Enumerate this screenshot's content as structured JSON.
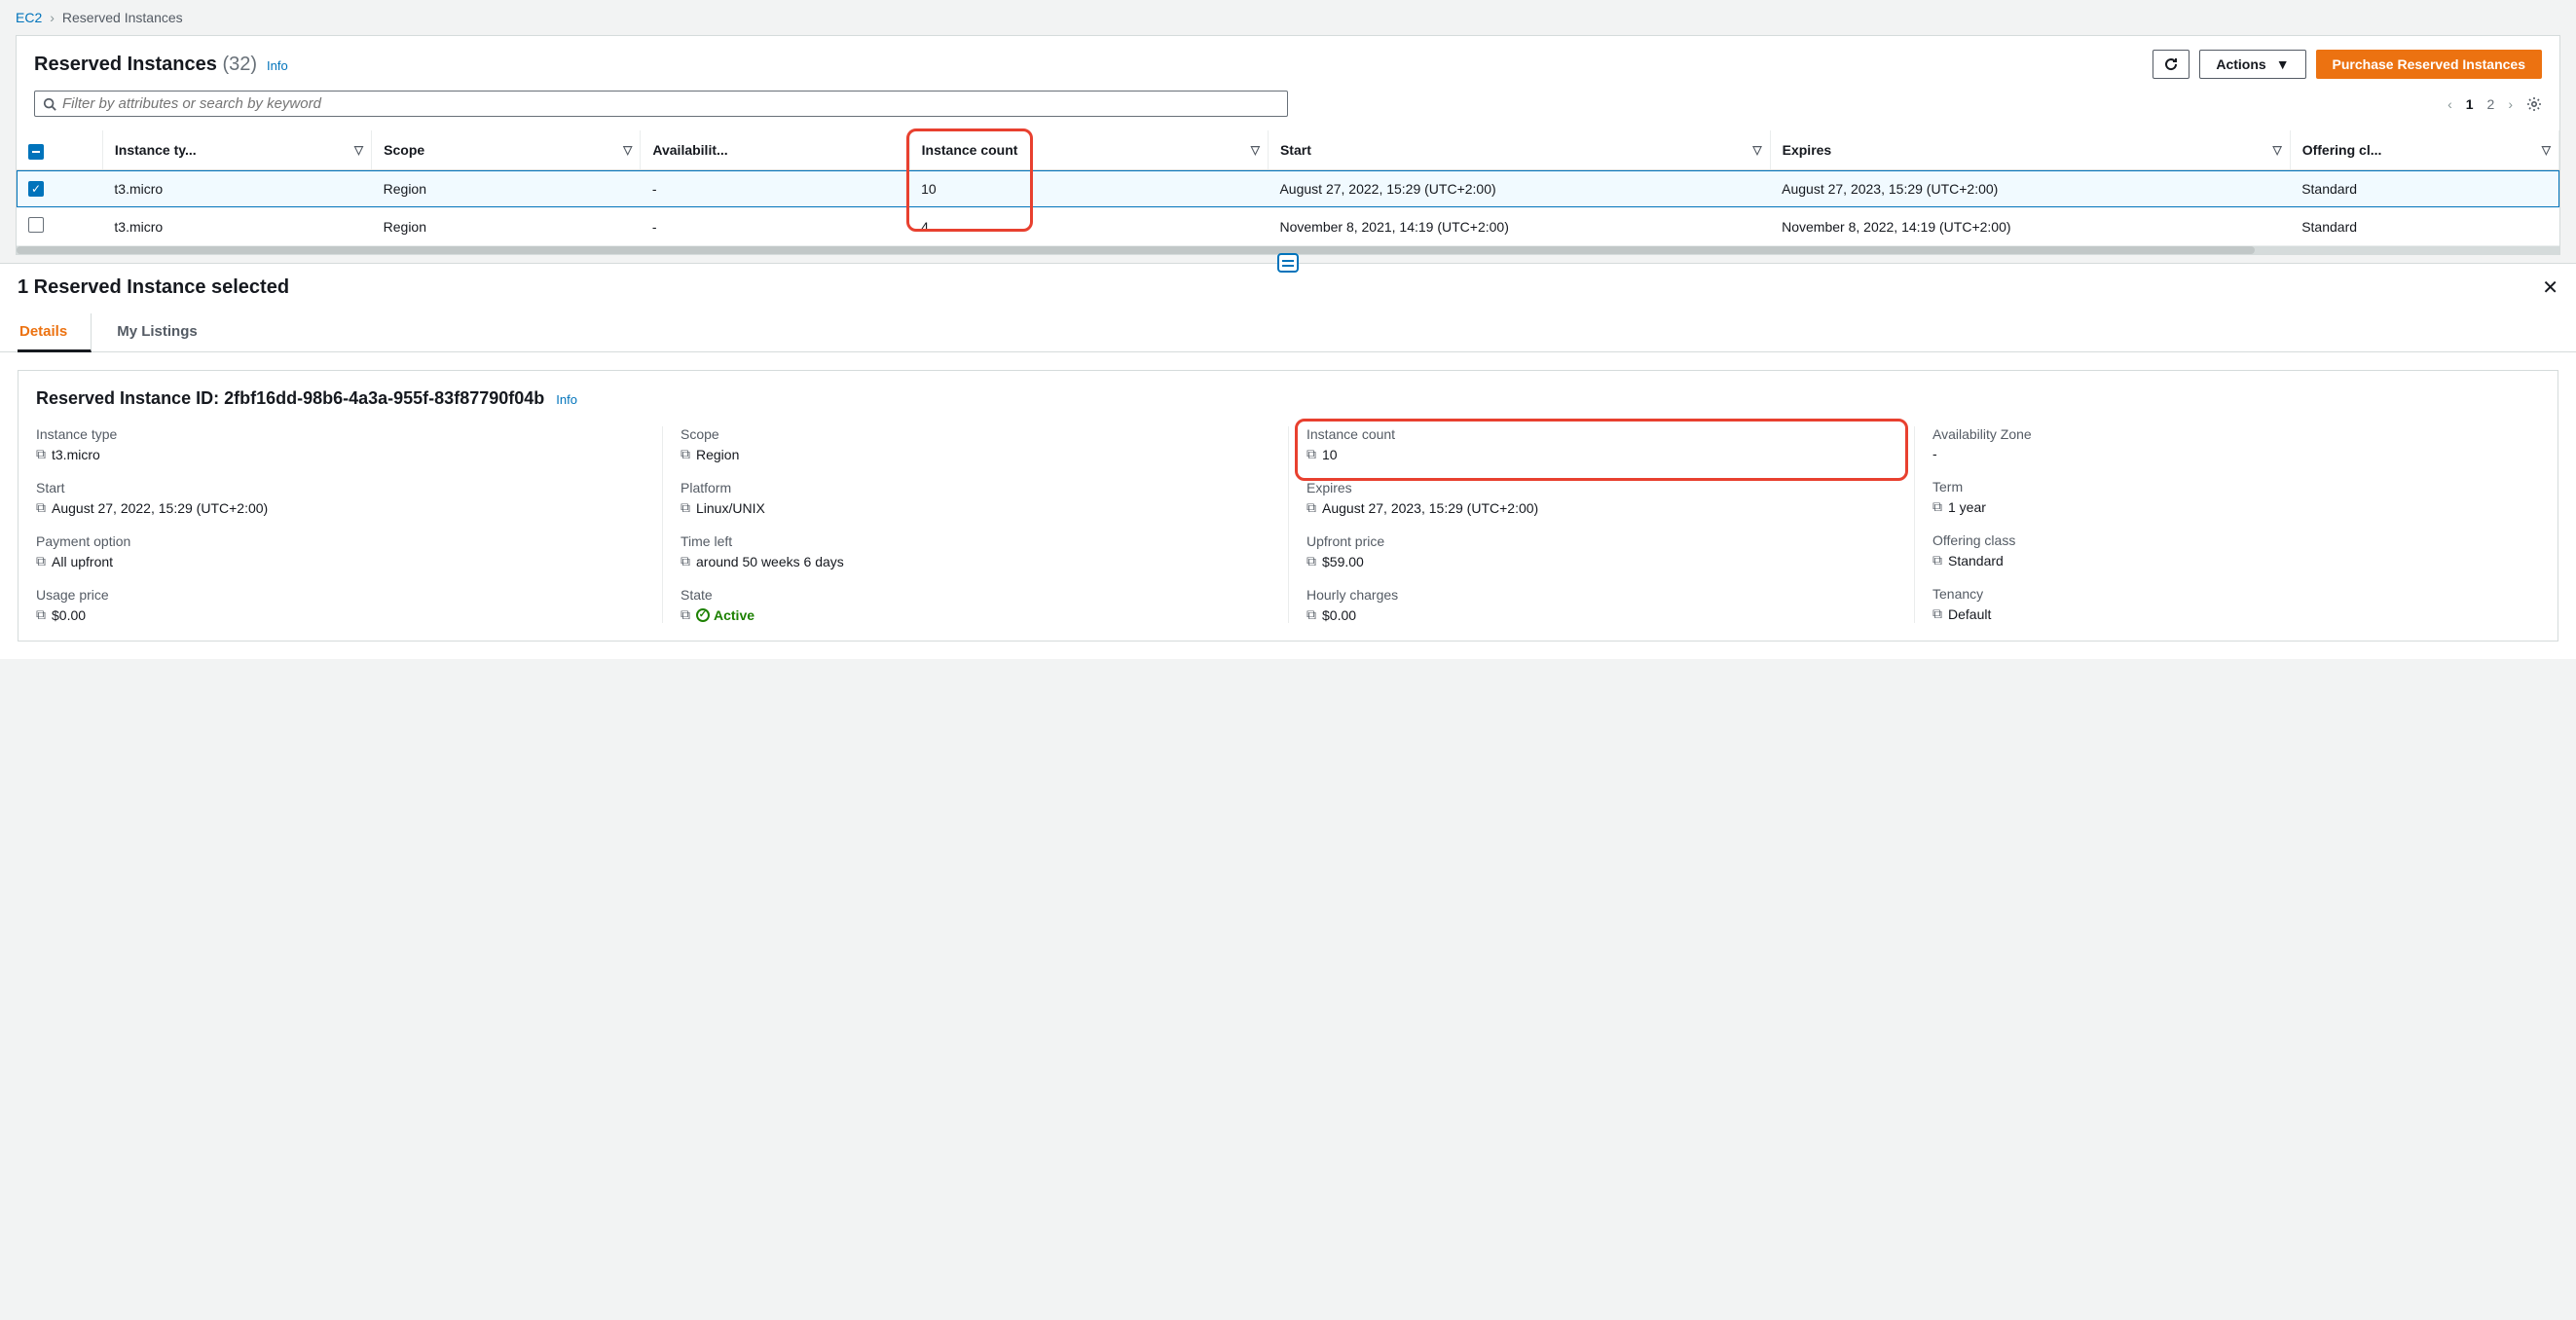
{
  "breadcrumb": {
    "root": "EC2",
    "current": "Reserved Instances"
  },
  "header": {
    "title": "Reserved Instances",
    "count": "(32)",
    "info": "Info",
    "actions_label": "Actions",
    "purchase_label": "Purchase Reserved Instances"
  },
  "search": {
    "placeholder": "Filter by attributes or search by keyword"
  },
  "pagination": {
    "page1": "1",
    "page2": "2"
  },
  "columns": {
    "instance_type": "Instance ty...",
    "scope": "Scope",
    "availability": "Availabilit...",
    "instance_count": "Instance count",
    "start": "Start",
    "expires": "Expires",
    "offering": "Offering cl..."
  },
  "rows": [
    {
      "selected": true,
      "instance_type": "t3.micro",
      "scope": "Region",
      "availability": "-",
      "instance_count": "10",
      "start": "August 27, 2022, 15:29 (UTC+2:00)",
      "expires": "August 27, 2023, 15:29 (UTC+2:00)",
      "offering": "Standard"
    },
    {
      "selected": false,
      "instance_type": "t3.micro",
      "scope": "Region",
      "availability": "-",
      "instance_count": "4",
      "start": "November 8, 2021, 14:19 (UTC+2:00)",
      "expires": "November 8, 2022, 14:19 (UTC+2:00)",
      "offering": "Standard"
    }
  ],
  "detail_header": {
    "title": "1 Reserved Instance selected"
  },
  "tabs": {
    "details": "Details",
    "listings": "My Listings"
  },
  "detail": {
    "id_label": "Reserved Instance ID:",
    "id_value": "2fbf16dd-98b6-4a3a-955f-83f87790f04b",
    "info": "Info",
    "fields": {
      "instance_type": {
        "k": "Instance type",
        "v": "t3.micro"
      },
      "scope": {
        "k": "Scope",
        "v": "Region"
      },
      "instance_count": {
        "k": "Instance count",
        "v": "10"
      },
      "az": {
        "k": "Availability Zone",
        "v": "-"
      },
      "start": {
        "k": "Start",
        "v": "August 27, 2022, 15:29 (UTC+2:00)"
      },
      "platform": {
        "k": "Platform",
        "v": "Linux/UNIX"
      },
      "expires": {
        "k": "Expires",
        "v": "August 27, 2023, 15:29 (UTC+2:00)"
      },
      "term": {
        "k": "Term",
        "v": "1 year"
      },
      "payment": {
        "k": "Payment option",
        "v": "All upfront"
      },
      "time_left": {
        "k": "Time left",
        "v": "around 50 weeks 6 days"
      },
      "upfront": {
        "k": "Upfront price",
        "v": "$59.00"
      },
      "offering": {
        "k": "Offering class",
        "v": "Standard"
      },
      "usage": {
        "k": "Usage price",
        "v": "$0.00"
      },
      "state": {
        "k": "State",
        "v": "Active"
      },
      "hourly": {
        "k": "Hourly charges",
        "v": "$0.00"
      },
      "tenancy": {
        "k": "Tenancy",
        "v": "Default"
      }
    }
  }
}
